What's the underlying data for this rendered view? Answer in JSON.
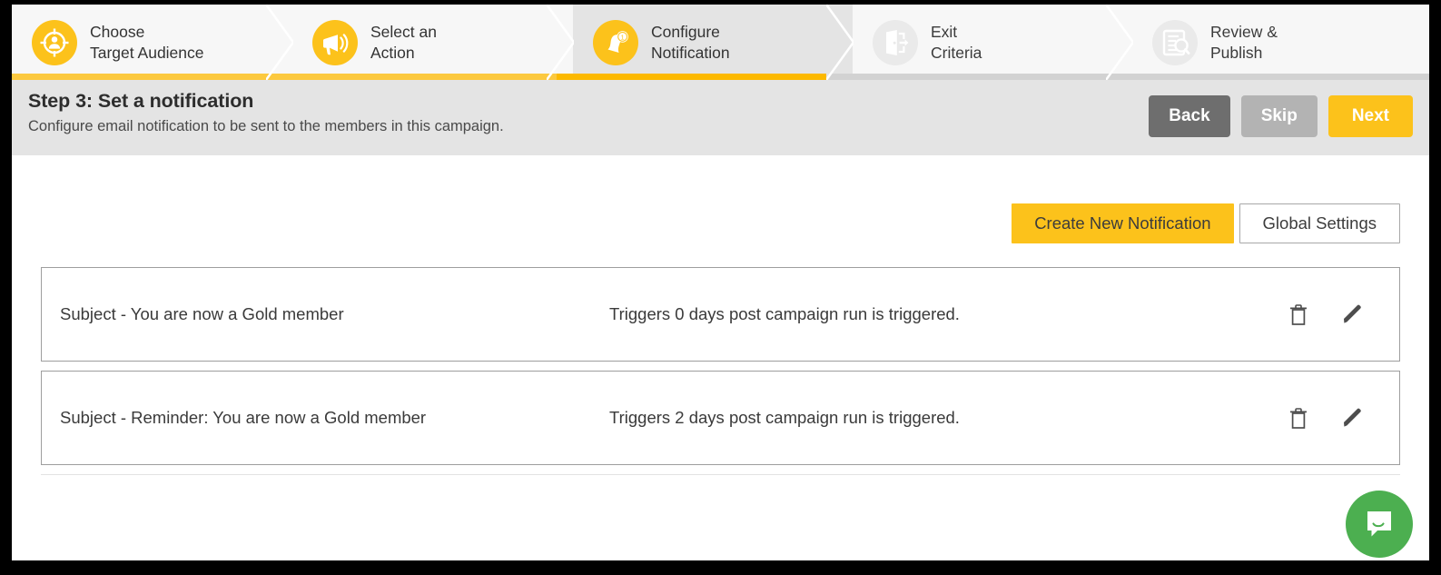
{
  "wizard": {
    "steps": [
      {
        "line1": "Choose",
        "line2": "Target Audience",
        "icon": "target-audience-icon",
        "state": "done"
      },
      {
        "line1": "Select an",
        "line2": "Action",
        "icon": "megaphone-icon",
        "state": "done"
      },
      {
        "line1": "Configure",
        "line2": "Notification",
        "icon": "bell-notification-icon",
        "state": "active"
      },
      {
        "line1": "Exit",
        "line2": "Criteria",
        "icon": "exit-door-icon",
        "state": "inactive"
      },
      {
        "line1": "Review &",
        "line2": "Publish",
        "icon": "document-search-icon",
        "state": "inactive"
      }
    ],
    "progress_done_color": "#fcc93f",
    "progress_current_color": "#fcb900",
    "progress_remaining_color": "#d2d2d2",
    "accent_color": "#fcc21b"
  },
  "stepbar": {
    "title": "Step 3: Set a notification",
    "subtitle": "Configure email notification to be sent to the members in this campaign.",
    "back_label": "Back",
    "skip_label": "Skip",
    "next_label": "Next"
  },
  "toolbar": {
    "create_label": "Create New Notification",
    "global_settings_label": "Global Settings"
  },
  "notifications": [
    {
      "subject": "Subject - You are now a Gold member",
      "trigger": "Triggers 0 days post campaign run is triggered.",
      "delete_title": "Delete",
      "edit_title": "Edit"
    },
    {
      "subject": "Subject - Reminder: You are now a Gold member",
      "trigger": "Triggers 2 days post campaign run is triggered.",
      "delete_title": "Delete",
      "edit_title": "Edit"
    }
  ],
  "chat": {
    "icon": "chat-bubble-icon",
    "color": "#4caf50"
  }
}
